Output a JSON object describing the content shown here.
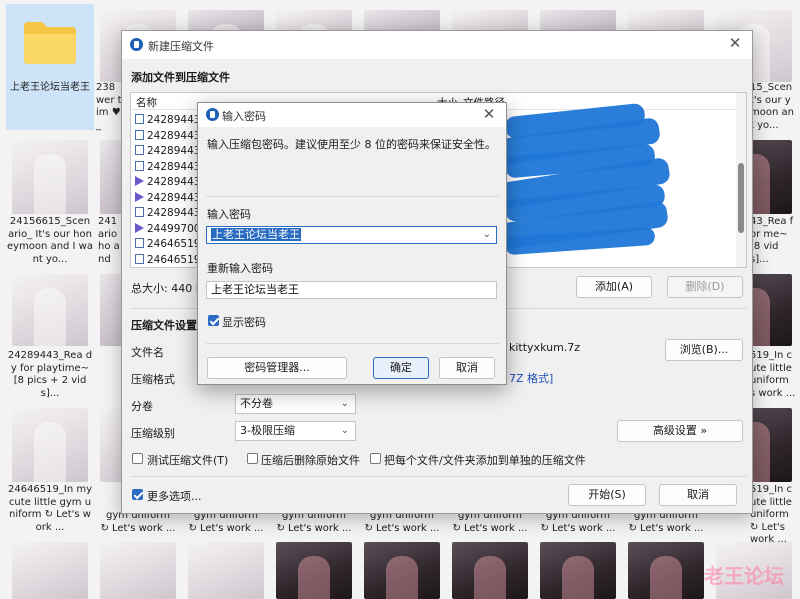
{
  "explorer": {
    "folder": {
      "name": "上老王论坛当老王"
    },
    "tiles_row1": [
      "238 wer tim ♥_",
      "15_Scen t's our ymoon ant yo..."
    ],
    "tiles_row2": [
      "24156615_Scen ario_ It's our honeymoon and I want yo...",
      "241 ario ho and",
      "43_Rea for me~ [8 vids]..."
    ],
    "tiles_row3": [
      "24289443_Rea dy for playtime~ [8 pics + 2 vids]...",
      "519_In cute little uniform s work ..."
    ],
    "tiles_row4": [
      "24646519_In my cute little gym uniform ↻ Let's work ...",
      "519_In cute little uniform ↻ Let's work ..."
    ],
    "bottom_captions": [
      "gym uniform",
      "↻ Let's work ..."
    ],
    "watermark": "老王论坛"
  },
  "main_dialog": {
    "title": "新建压缩文件",
    "section_add": "添加文件到压缩文件",
    "columns": {
      "name": "名称",
      "size": "大小",
      "path": "文件路径"
    },
    "rows": [
      {
        "name": "24289443_",
        "type": "img"
      },
      {
        "name": "24289443_",
        "type": "img"
      },
      {
        "name": "24289443_",
        "type": "img"
      },
      {
        "name": "24289443_",
        "type": "img"
      },
      {
        "name": "24289443_",
        "type": "vid"
      },
      {
        "name": "24289443_",
        "type": "vid"
      },
      {
        "name": "24289443_",
        "type": "img"
      },
      {
        "name": "24499700_",
        "type": "vid"
      },
      {
        "name": "24646519_",
        "type": "img"
      },
      {
        "name": "24646519_",
        "type": "img"
      }
    ],
    "total_size": "总大小: 440 M",
    "add_button": "添加(A)",
    "delete_button": "删除(D)",
    "section_settings": "压缩文件设置",
    "filename_label": "文件名",
    "filename_value": "kittyxkum.7z",
    "browse_button": "浏览(B)...",
    "format_label": "压缩格式",
    "format_hint": "7Z 格式]",
    "volume_label": "分卷",
    "volume_value": "不分卷",
    "level_label": "压缩级别",
    "level_value": "3-极限压缩",
    "advanced_button": "高级设置 »",
    "check_test": "测试压缩文件(T)",
    "check_delete": "压缩后删除原始文件",
    "check_each": "把每个文件/文件夹添加到单独的压缩文件",
    "more_options": "更多选项...",
    "start_button": "开始(S)",
    "cancel_button": "取消"
  },
  "password_dialog": {
    "title": "输入密码",
    "description": "输入压缩包密码。建议使用至少 8 位的密码来保证安全性。",
    "password_label": "输入密码",
    "password_value": "上老王论坛当老王",
    "reenter_label": "重新输入密码",
    "reenter_value": "上老王论坛当老王",
    "show_password": "显示密码",
    "manager_button": "密码管理器...",
    "ok_button": "确定",
    "cancel_button": "取消"
  },
  "colors": {
    "accent": "#2a6bc2",
    "scribble": "#1f77d8",
    "folder": "#f7c646"
  }
}
